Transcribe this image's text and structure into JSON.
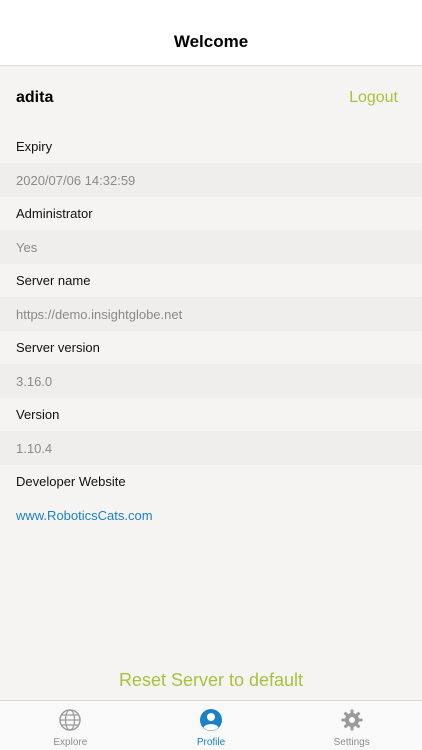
{
  "navbar": {
    "title": "Welcome"
  },
  "user": {
    "name": "adita",
    "logout_label": "Logout"
  },
  "info": {
    "items": [
      {
        "label": "Expiry",
        "value": "2020/07/06 14:32:59"
      },
      {
        "label": "Administrator",
        "value": "Yes"
      },
      {
        "label": "Server name",
        "value": "https://demo.insightglobe.net"
      },
      {
        "label": "Server version",
        "value": "3.16.0"
      },
      {
        "label": "Version",
        "value": "1.10.4"
      },
      {
        "label": "Developer Website",
        "value": "www.RoboticsCats.com"
      }
    ]
  },
  "reset": {
    "label": "Reset Server to default"
  },
  "tabbar": {
    "tabs": [
      {
        "label": "Explore",
        "icon": "globe-icon",
        "active": false
      },
      {
        "label": "Profile",
        "icon": "person-icon",
        "active": true
      },
      {
        "label": "Settings",
        "icon": "gear-icon",
        "active": false
      }
    ]
  },
  "colors": {
    "accent_green": "#a8c23c",
    "link_blue": "#1a80c8",
    "tab_inactive": "#8e8e8e"
  }
}
